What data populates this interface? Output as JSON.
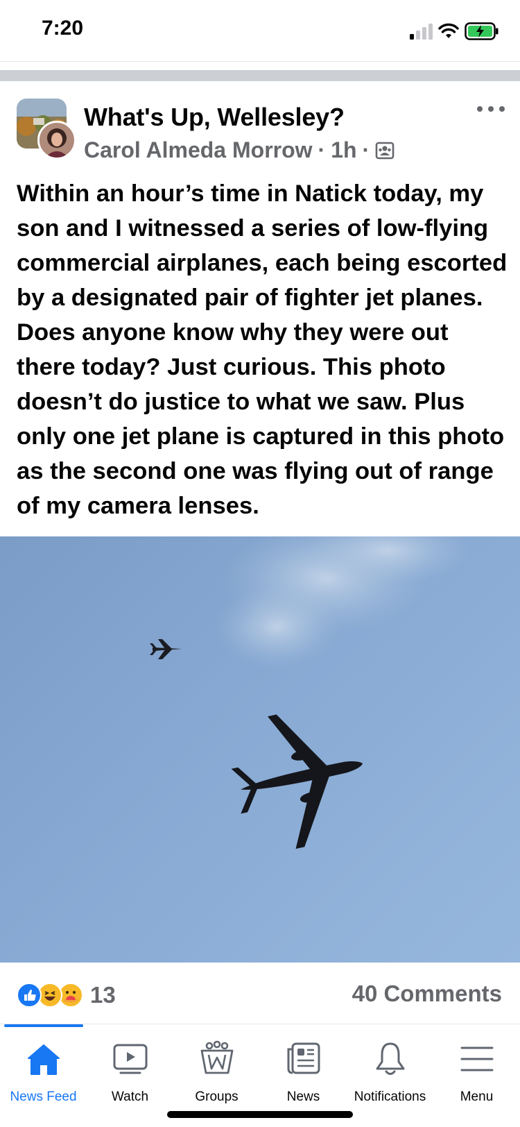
{
  "status_bar": {
    "time": "7:20"
  },
  "post": {
    "group_name": "What's Up, Wellesley?",
    "author": "Carol Almeda Morrow",
    "time": "1h",
    "separator": "·",
    "text": "Within an hour’s time in Natick today, my son and I witnessed a series of low-flying commercial airplanes, each being escorted by a designated pair of fighter jet planes. Does anyone know why they were out there today? Just curious. This photo doesn’t do justice to what we saw. Plus only one jet plane is captured in this photo as the second one was flying out of range of my camera lenses.",
    "reactions_count": "13",
    "comments_label": "40 Comments"
  },
  "tabbar": {
    "tabs": [
      {
        "label": "News Feed",
        "icon": "home-icon",
        "active": true
      },
      {
        "label": "Watch",
        "icon": "watch-icon",
        "active": false
      },
      {
        "label": "Groups",
        "icon": "groups-icon",
        "active": false
      },
      {
        "label": "News",
        "icon": "news-icon",
        "active": false
      },
      {
        "label": "Notifications",
        "icon": "bell-icon",
        "active": false
      },
      {
        "label": "Menu",
        "icon": "menu-icon",
        "active": false
      }
    ]
  },
  "colors": {
    "accent": "#1877f2",
    "secondary_text": "#65676b",
    "sky": "#8aaed6"
  }
}
